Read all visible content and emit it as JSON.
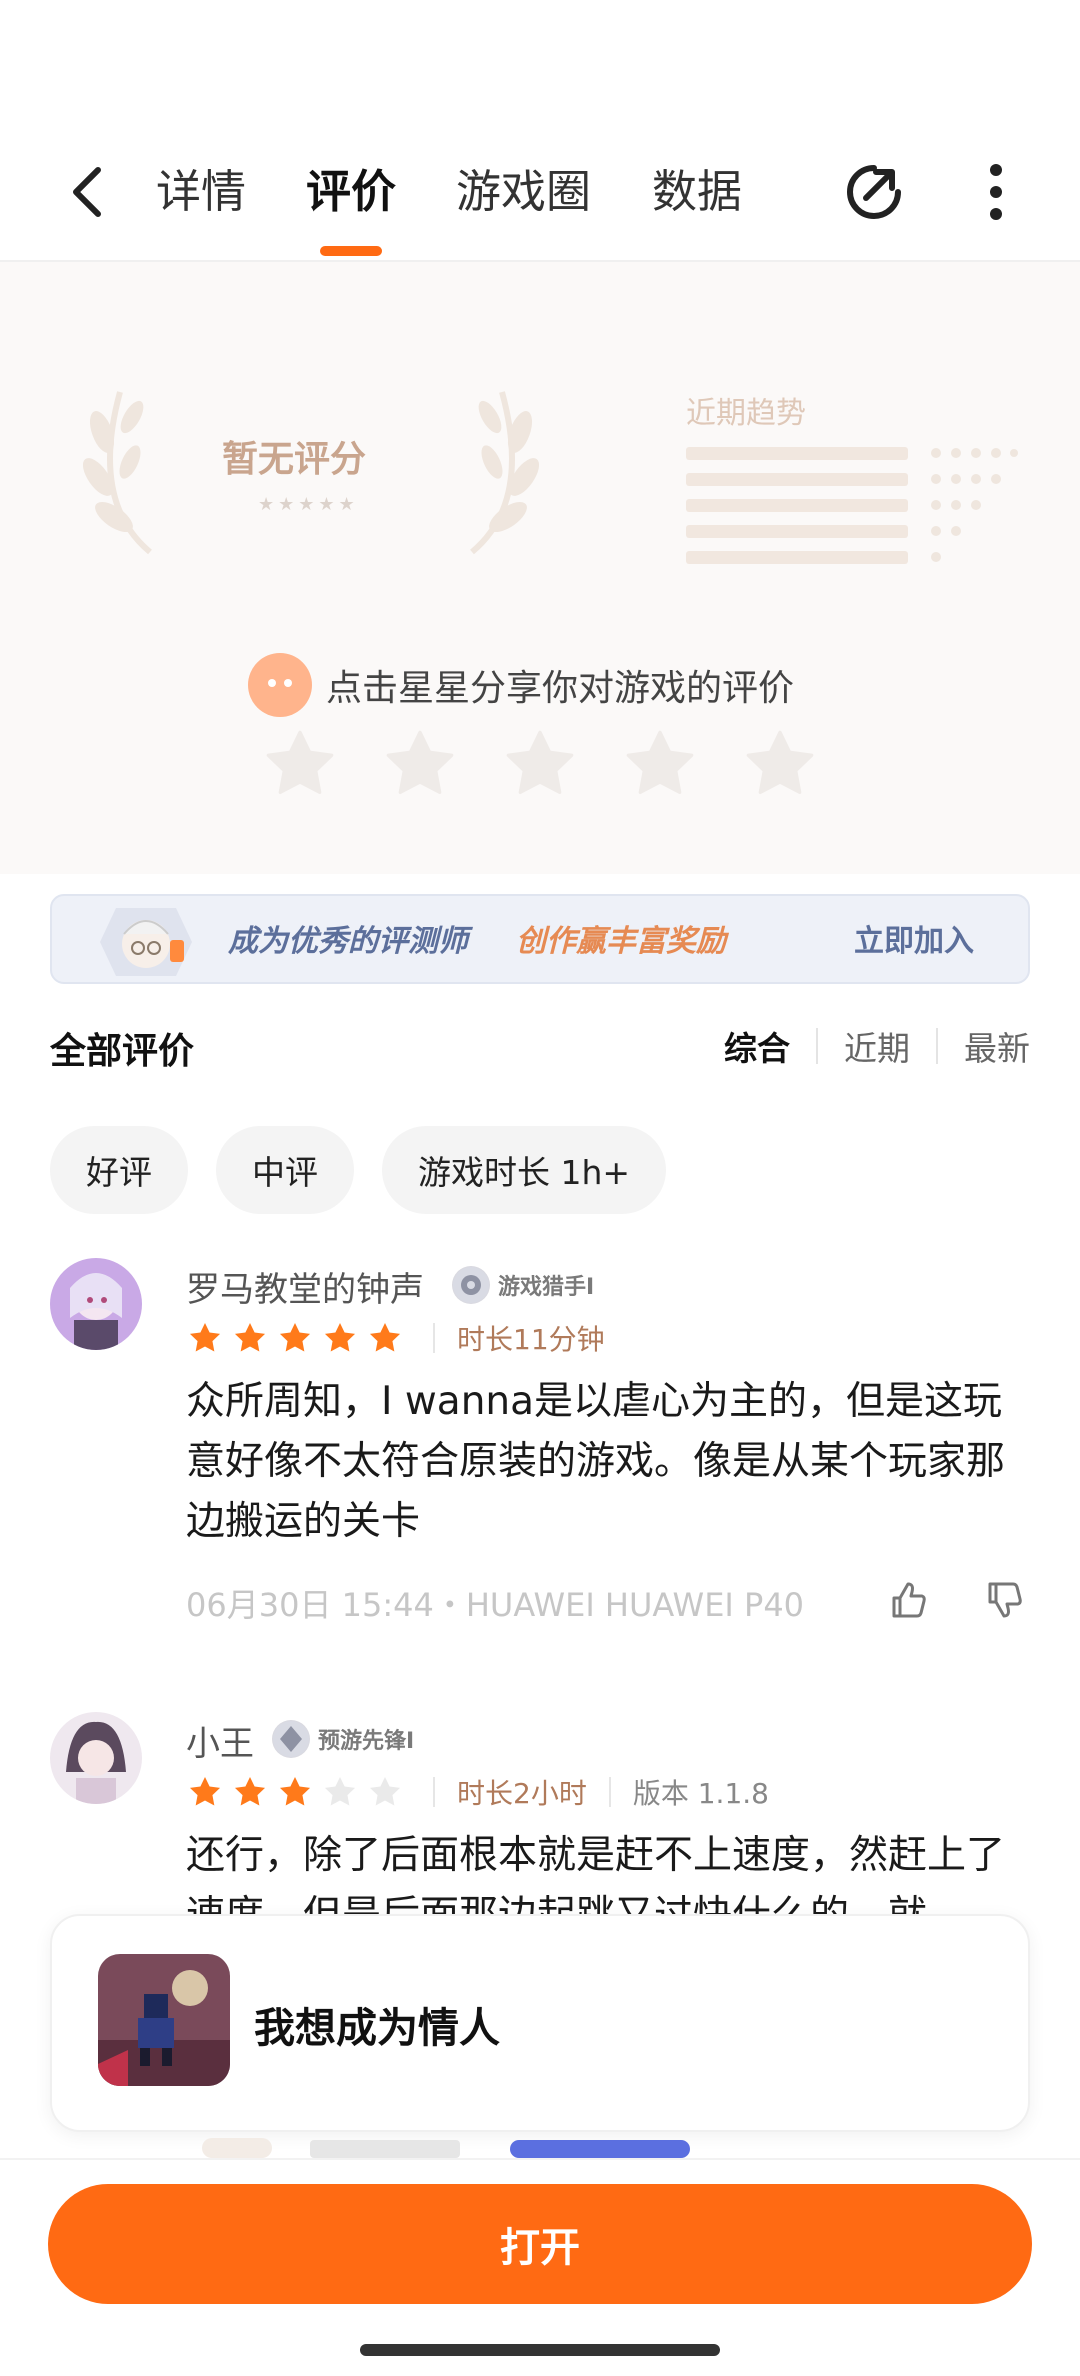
{
  "nav": {
    "tabs": [
      {
        "label": "详情"
      },
      {
        "label": "评价"
      },
      {
        "label": "游戏圈"
      },
      {
        "label": "数据"
      }
    ],
    "active_tab": "评价"
  },
  "rating": {
    "no_score": "暂无评分",
    "trend_label": "近期趋势",
    "prompt": "点击星星分享你对游戏的评价"
  },
  "banner": {
    "text1": "成为优秀的评测师",
    "text2": "创作赢丰富奖励",
    "action": "立即加入"
  },
  "reviews_section": {
    "title": "全部评价",
    "sorts": [
      "综合",
      "近期",
      "最新"
    ],
    "active_sort": "综合",
    "filters": [
      "好评",
      "中评",
      "游戏时长 1h+"
    ]
  },
  "reviews": [
    {
      "user": "罗马教堂的钟声",
      "badge": "游戏猎手I",
      "stars": 5,
      "playtime": "时长11分钟",
      "body": "众所周知，I wanna是以虐心为主的，但是这玩意好像不太符合原装的游戏。像是从某个玩家那边搬运的关卡",
      "footer": "06月30日 15:44・HUAWEI HUAWEI P40"
    },
    {
      "user": "小王",
      "badge": "预游先锋I",
      "stars": 3,
      "playtime": "时长2小时",
      "version": "版本 1.1.8",
      "body": "还行，除了后面根本就是赶不上速度，然赶上了速度，但是后面那边起跳又过快什么的，就"
    }
  ],
  "game_card": {
    "title": "我想成为情人"
  },
  "bottom": {
    "open_label": "打开"
  },
  "colors": {
    "accent": "#ff6a13",
    "star_filled": "#ff7a1a",
    "star_empty": "#e6e6e6"
  }
}
